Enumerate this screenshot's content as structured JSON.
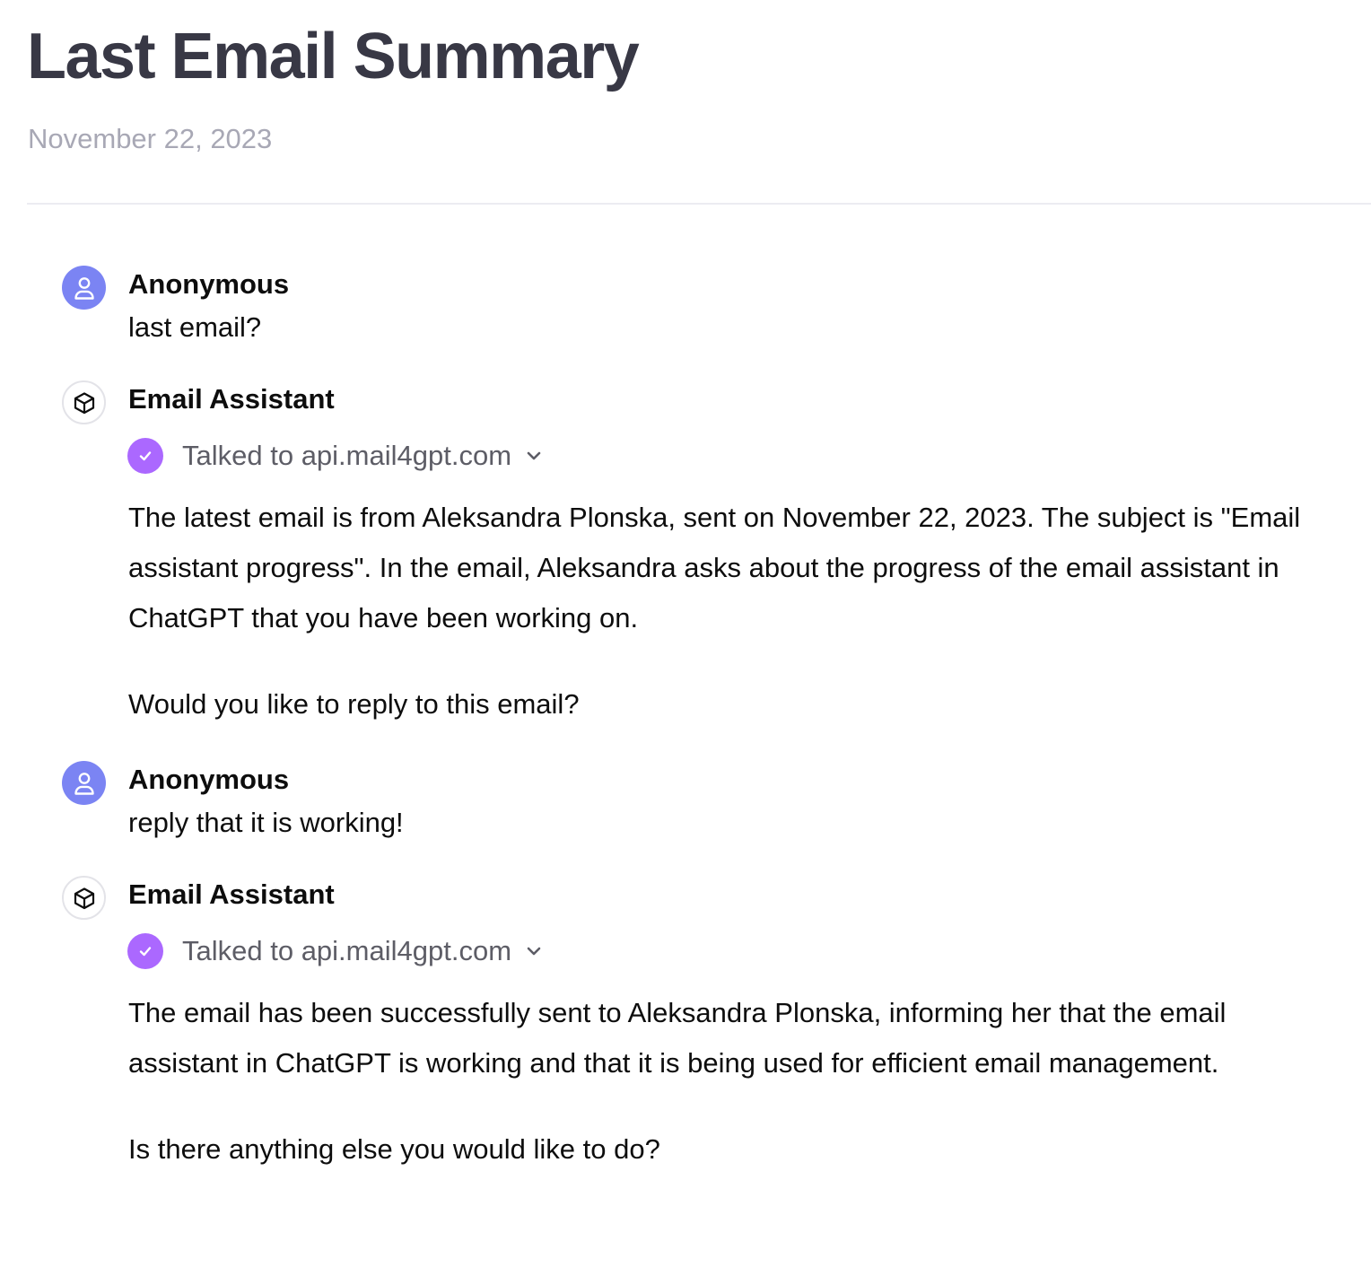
{
  "title": "Last Email Summary",
  "date": "November 22, 2023",
  "messages": [
    {
      "role": "user",
      "author": "Anonymous",
      "text": "last email?"
    },
    {
      "role": "assistant",
      "author": "Email Assistant",
      "tool_status": "Talked to api.mail4gpt.com",
      "paragraphs": [
        "The latest email is from Aleksandra Plonska, sent on November 22, 2023. The subject is \"Email assistant progress\". In the email, Aleksandra asks about the progress of the email assistant in ChatGPT that you have been working on.",
        "Would you like to reply to this email?"
      ]
    },
    {
      "role": "user",
      "author": "Anonymous",
      "text": "reply that it is working!"
    },
    {
      "role": "assistant",
      "author": "Email Assistant",
      "tool_status": "Talked to api.mail4gpt.com",
      "paragraphs": [
        "The email has been successfully sent to Aleksandra Plonska, informing her that the email assistant in ChatGPT is working and that it is being used for efficient email management.",
        "Is there anything else you would like to do?"
      ]
    }
  ],
  "icons": {
    "user_avatar": "user-icon",
    "assistant_avatar": "cube-icon",
    "tool_status": "check-icon",
    "expand": "chevron-down-icon"
  },
  "colors": {
    "title": "#383845",
    "date": "#a8a8b5",
    "user_avatar_bg": "#7b84f3",
    "check_bg": "#ab68ff",
    "tool_label": "#5d5d66"
  }
}
